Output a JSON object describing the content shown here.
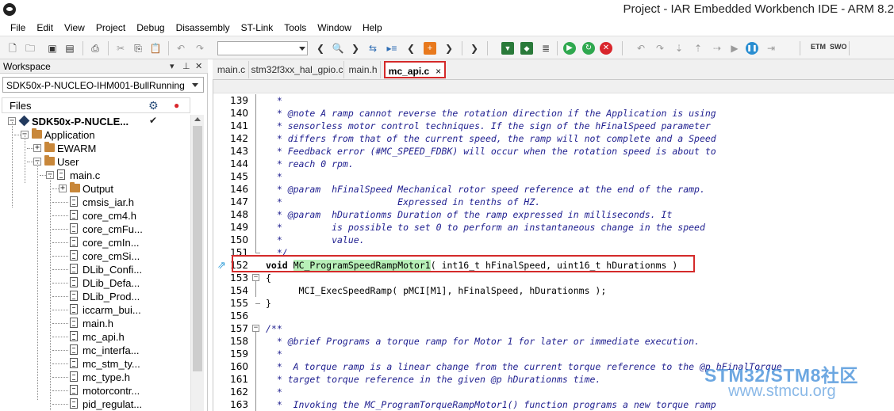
{
  "window": {
    "title": "Project - IAR Embedded Workbench IDE - ARM 8.2"
  },
  "menu": [
    "File",
    "Edit",
    "View",
    "Project",
    "Debug",
    "Disassembly",
    "ST-Link",
    "Tools",
    "Window",
    "Help"
  ],
  "toolbar": {
    "etm_label": "ETM",
    "swo_label": "SWO"
  },
  "workspace": {
    "title": "Workspace",
    "config": "SDK50x-P-NUCLEO-IHM001-BullRunning",
    "files_label": "Files",
    "tree": [
      {
        "label": "SDK50x-P-NUCLE...",
        "type": "project",
        "level": 0,
        "expander": "−",
        "bold": true,
        "checked": true
      },
      {
        "label": "Application",
        "type": "folder",
        "level": 1,
        "expander": "−"
      },
      {
        "label": "EWARM",
        "type": "folder",
        "level": 2,
        "expander": "+"
      },
      {
        "label": "User",
        "type": "folder",
        "level": 2,
        "expander": "−"
      },
      {
        "label": "main.c",
        "type": "file",
        "level": 3,
        "expander": "−"
      },
      {
        "label": "Output",
        "type": "folder",
        "level": 4,
        "expander": "+"
      },
      {
        "label": "cmsis_iar.h",
        "type": "file",
        "level": 4
      },
      {
        "label": "core_cm4.h",
        "type": "file",
        "level": 4
      },
      {
        "label": "core_cmFu...",
        "type": "file",
        "level": 4
      },
      {
        "label": "core_cmIn...",
        "type": "file",
        "level": 4
      },
      {
        "label": "core_cmSi...",
        "type": "file",
        "level": 4
      },
      {
        "label": "DLib_Confi...",
        "type": "file",
        "level": 4
      },
      {
        "label": "DLib_Defa...",
        "type": "file",
        "level": 4
      },
      {
        "label": "DLib_Prod...",
        "type": "file",
        "level": 4
      },
      {
        "label": "iccarm_bui...",
        "type": "file",
        "level": 4
      },
      {
        "label": "main.h",
        "type": "file",
        "level": 4
      },
      {
        "label": "mc_api.h",
        "type": "file",
        "level": 4
      },
      {
        "label": "mc_interfa...",
        "type": "file",
        "level": 4
      },
      {
        "label": "mc_stm_ty...",
        "type": "file",
        "level": 4
      },
      {
        "label": "mc_type.h",
        "type": "file",
        "level": 4
      },
      {
        "label": "motorcontr...",
        "type": "file",
        "level": 4
      },
      {
        "label": "pid_regulat...",
        "type": "file",
        "level": 4
      }
    ]
  },
  "editor": {
    "tabs": [
      {
        "label": "main.c",
        "active": false
      },
      {
        "label": "stm32f3xx_hal_gpio.c",
        "active": false
      },
      {
        "label": "main.h",
        "active": false
      },
      {
        "label": "mc_api.c",
        "active": true,
        "close": "×"
      }
    ],
    "lines": [
      {
        "n": "139",
        "text": "  *",
        "kind": "comment"
      },
      {
        "n": "140",
        "text": "  * @note A ramp cannot reverse the rotation direction if the Application is using",
        "kind": "comment"
      },
      {
        "n": "141",
        "text": "  * sensorless motor control techniques. If the sign of the hFinalSpeed parameter",
        "kind": "comment"
      },
      {
        "n": "142",
        "text": "  * differs from that of the current speed, the ramp will not complete and a Speed",
        "kind": "comment"
      },
      {
        "n": "143",
        "text": "  * Feedback error (#MC_SPEED_FDBK) will occur when the rotation speed is about to",
        "kind": "comment"
      },
      {
        "n": "144",
        "text": "  * reach 0 rpm.",
        "kind": "comment"
      },
      {
        "n": "145",
        "text": "  *",
        "kind": "comment"
      },
      {
        "n": "146",
        "text": "  * @param  hFinalSpeed Mechanical rotor speed reference at the end of the ramp.",
        "kind": "comment"
      },
      {
        "n": "147",
        "text": "  *                     Expressed in tenths of HZ.",
        "kind": "comment"
      },
      {
        "n": "148",
        "text": "  * @param  hDurationms Duration of the ramp expressed in milliseconds. It",
        "kind": "comment"
      },
      {
        "n": "149",
        "text": "  *         is possible to set 0 to perform an instantaneous change in the speed",
        "kind": "comment"
      },
      {
        "n": "150",
        "text": "  *         value.",
        "kind": "comment"
      },
      {
        "n": "151",
        "text": "  */",
        "kind": "comment"
      },
      {
        "n": "152",
        "kw": "void",
        "fn": "MC_ProgramSpeedRampMotor1",
        "rest": "( int16_t hFinalSpeed, uint16_t hDurationms )",
        "kind": "decl"
      },
      {
        "n": "153",
        "text": "{",
        "kind": "code",
        "fold": "−"
      },
      {
        "n": "154",
        "text": "      MCI_ExecSpeedRamp( pMCI[M1], hFinalSpeed, hDurationms );",
        "kind": "code"
      },
      {
        "n": "155",
        "text": "}",
        "kind": "code"
      },
      {
        "n": "156",
        "text": "",
        "kind": "code"
      },
      {
        "n": "157",
        "text": "/**",
        "kind": "comment",
        "fold": "−"
      },
      {
        "n": "158",
        "text": "  * @brief Programs a torque ramp for Motor 1 for later or immediate execution.",
        "kind": "comment"
      },
      {
        "n": "159",
        "text": "  *",
        "kind": "comment"
      },
      {
        "n": "160",
        "text": "  *  A torque ramp is a linear change from the current torque reference to the @p hFinalTorque",
        "kind": "comment"
      },
      {
        "n": "161",
        "text": "  * target torque reference in the given @p hDurationms time.",
        "kind": "comment"
      },
      {
        "n": "162",
        "text": "  *",
        "kind": "comment"
      },
      {
        "n": "163",
        "text": "  *  Invoking the MC_ProgramTorqueRampMotor1() function programs a new torque ramp",
        "kind": "comment"
      }
    ]
  },
  "watermark": {
    "brand": "STM32/STM8社区",
    "url": "www.stmcu.org"
  },
  "colors": {
    "highlight": "#d42a2a",
    "comment": "#1f1f8f",
    "function_bg": "#b8f0b8"
  }
}
